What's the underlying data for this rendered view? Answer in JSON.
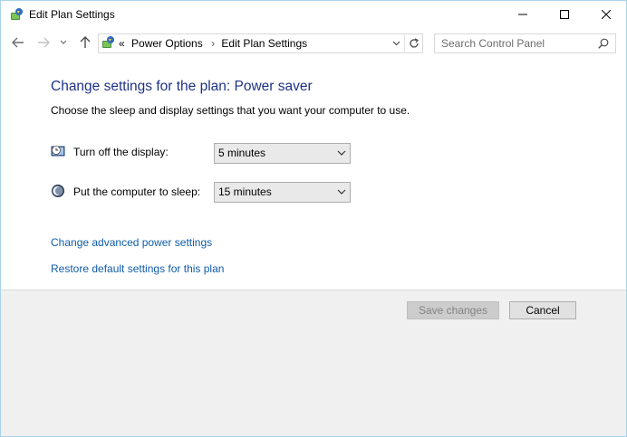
{
  "window": {
    "title": "Edit Plan Settings",
    "controls": {
      "minimize": "minimize",
      "maximize": "maximize",
      "close": "close"
    }
  },
  "navigation": {
    "address": {
      "overflow_marker": "«",
      "crumbs": [
        "Power Options",
        "Edit Plan Settings"
      ],
      "separator": "›"
    },
    "search": {
      "placeholder": "Search Control Panel"
    }
  },
  "content": {
    "heading": "Change settings for the plan: Power saver",
    "description": "Choose the sleep and display settings that you want your computer to use.",
    "settings": [
      {
        "label": "Turn off the display:",
        "value": "5 minutes",
        "icon": "display-icon"
      },
      {
        "label": "Put the computer to sleep:",
        "value": "15 minutes",
        "icon": "sleep-icon"
      }
    ],
    "links": {
      "advanced": "Change advanced power settings",
      "restore": "Restore default settings for this plan"
    }
  },
  "buttons": {
    "save": "Save changes",
    "save_enabled": false,
    "cancel": "Cancel"
  },
  "colors": {
    "heading": "#1e3287",
    "link": "#0f5ca8",
    "window_border": "#a9d3ea",
    "footer_bg": "#f0f0f0"
  }
}
